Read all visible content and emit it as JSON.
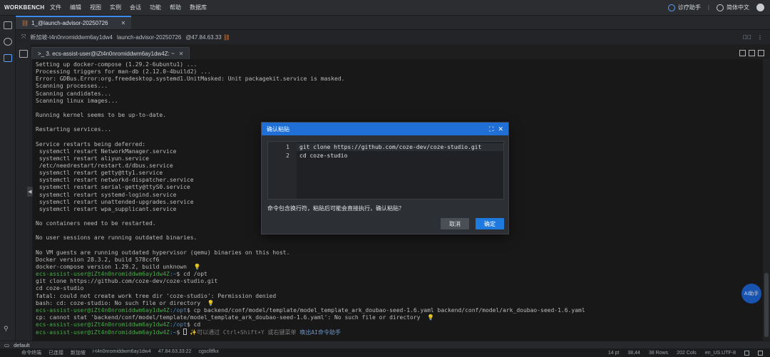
{
  "menubar": {
    "brand": "WORKBENCH",
    "items": [
      "文件",
      "编辑",
      "视图",
      "实例",
      "会话",
      "功能",
      "帮助",
      "数据库"
    ],
    "assistant": "诊疗助手",
    "language": "简体中文"
  },
  "tabs": {
    "main": "1_@launch-advisor-20250726",
    "session_bar": {
      "instance": "新加坡-t4n0nromiddwm6ay1dw4",
      "name": "launch-advisor-20250726",
      "ip": "@47.84.63.33"
    },
    "terminal_tab": ">_ 3. ecs-assist-user@iZt4n0nromiddwm6ay1dw4Z: ~"
  },
  "terminal": {
    "lines": [
      {
        "t": "Setting up docker-compose (1.29.2-6ubuntu1) ..."
      },
      {
        "t": "Processing triggers for man-db (2.12.0-4build2) ..."
      },
      {
        "t": "Error: GDBus.Error:org.freedesktop.systemd1.UnitMasked: Unit packagekit.service is masked."
      },
      {
        "t": "Scanning processes..."
      },
      {
        "t": "Scanning candidates..."
      },
      {
        "t": "Scanning linux images..."
      },
      {
        "t": ""
      },
      {
        "t": "Running kernel seems to be up-to-date."
      },
      {
        "t": ""
      },
      {
        "t": "Restarting services..."
      },
      {
        "t": ""
      },
      {
        "t": "Service restarts being deferred:"
      },
      {
        "t": " systemctl restart NetworkManager.service"
      },
      {
        "t": " systemctl restart aliyun.service"
      },
      {
        "t": " /etc/needrestart/restart.d/dbus.service"
      },
      {
        "t": " systemctl restart getty@tty1.service"
      },
      {
        "t": " systemctl restart networkd-dispatcher.service"
      },
      {
        "t": " systemctl restart serial-getty@ttyS0.service"
      },
      {
        "t": " systemctl restart systemd-logind.service"
      },
      {
        "t": " systemctl restart unattended-upgrades.service"
      },
      {
        "t": " systemctl restart wpa_supplicant.service"
      },
      {
        "t": ""
      },
      {
        "t": "No containers need to be restarted."
      },
      {
        "t": ""
      },
      {
        "t": "No user sessions are running outdated binaries."
      },
      {
        "t": ""
      },
      {
        "t": "No VM guests are running outdated hypervisor (qemu) binaries on this host."
      },
      {
        "t": "Docker version 28.3.2, build 578ccf6"
      },
      {
        "t": "docker-compose version 1.29.2, build unknown  💡"
      },
      {
        "p": "ecs-assist-user@iZt4n0nromiddwm6ay1dw4Z",
        "d": ":~",
        "c": "$ cd /opt"
      },
      {
        "t": "git clone https://github.com/coze-dev/coze-studio.git"
      },
      {
        "t": "cd coze-studio"
      },
      {
        "t": "fatal: could not create work tree dir 'coze-studio': Permission denied"
      },
      {
        "t": "bash: cd: coze-studio: No such file or directory  💡"
      },
      {
        "p": "ecs-assist-user@iZt4n0nromiddwm6ay1dw4Z",
        "d": ":/opt",
        "c": "$ cp backend/conf/model/template/model_template_ark_doubao-seed-1.6.yaml backend/conf/model/ark_doubao-seed-1.6.yaml"
      },
      {
        "t": "cp: cannot stat 'backend/conf/model/template/model_template_ark_doubao-seed-1.6.yaml': No such file or directory  💡"
      },
      {
        "p": "ecs-assist-user@iZt4n0nromiddwm6ay1dw4Z",
        "d": ":/opt",
        "c": "$ cd"
      },
      {
        "p": "ecs-assist-user@iZt4n0nromiddwm6ay1dw4Z",
        "d": ":~",
        "c": "$ ",
        "cursor": true,
        "hint": "✨可以通过 Ctrl+Shift+Y 或右键菜单 ",
        "hint_link": "唤出AI命令助手"
      }
    ]
  },
  "dialog": {
    "title": "确认粘贴",
    "code_lines": [
      {
        "num": "1",
        "text": "git clone https://github.com/coze-dev/coze-studio.git"
      },
      {
        "num": "2",
        "text": "cd coze-studio"
      }
    ],
    "message": "命令包含换行符，粘贴后可能会直接执行，确认粘贴？",
    "cancel": "取消",
    "ok": "确定"
  },
  "float_button": "AI助手",
  "status": {
    "default_tab": "default",
    "left": [
      "命令终端",
      "已连接",
      "新加坡",
      "i-t4n0nromiddwm6ay1dw4",
      "47.84.63.33:22",
      "cgsclltfkx"
    ],
    "font": "14 pt",
    "position": "38,44",
    "rows": "38 Rows",
    "cols": "202 Cols",
    "encoding": "en_US.UTF-8"
  }
}
